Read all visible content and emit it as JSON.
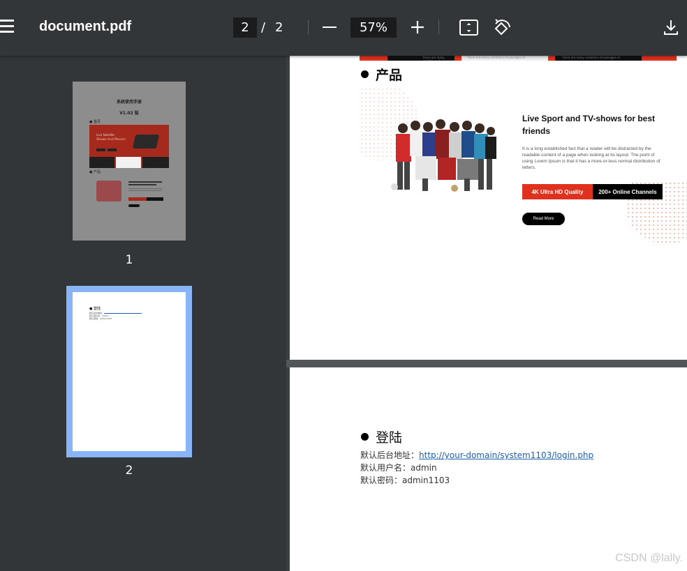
{
  "toolbar": {
    "title": "document.pdf",
    "current_page": "2",
    "page_separator": "/",
    "total_pages": "2",
    "zoom": "57%"
  },
  "sidebar": {
    "thumbnails": [
      {
        "number": "1",
        "selected": false
      },
      {
        "number": "2",
        "selected": true
      }
    ],
    "thumb1": {
      "title": "系统使用手册",
      "version": "V1.02 版",
      "section1": "首页",
      "section2": "产品",
      "banner_text1": "Live Satellite",
      "banner_text2": "Shows And Movies",
      "banner_btn1": "Learn More",
      "banner_btn2": "Read More"
    },
    "thumb2": {
      "heading": "登陆",
      "lines": [
        "默认后台地址：",
        "默认用户名：admin",
        "默认密码：admin1103"
      ]
    }
  },
  "page1": {
    "top_strip": [
      "There are many variations of passages of",
      "There are many variations of passages of",
      "There are many variations of passages of"
    ],
    "heading": "产品",
    "product": {
      "title": "Live Sport and TV-shows for best friends",
      "body": "It is a long established fact that a reader will be distracted by the readable content of a page when looking at its layout. The point of using Lorem Ipsum is that it has a more-or-less normal distribution of letters.",
      "badge_red": "4K Ultra HD Quality",
      "badge_black": "200+ Online Channels",
      "read_more": "Read More"
    }
  },
  "page2": {
    "heading": "登陆",
    "address_label": "默认后台地址：",
    "address_link": "http://your-domain/system1103/login.php",
    "username_line": "默认用户名：admin",
    "password_line": "默认密码：admin1103"
  },
  "watermark": "CSDN @lally.",
  "colors": {
    "toolbar": "#323639",
    "viewer_bg": "#525659",
    "selected_thumb": "#8ab4f8",
    "accent_red": "#e0301e",
    "link": "#1a5fb4"
  }
}
